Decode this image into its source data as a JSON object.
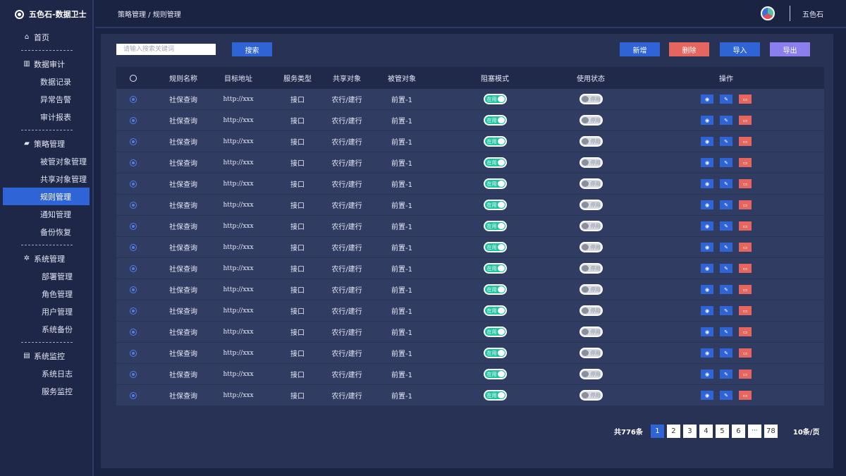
{
  "app": {
    "title": "五色石-数据卫士"
  },
  "header": {
    "breadcrumb": "策略管理 / 规则管理",
    "username": "五色石"
  },
  "sidebar": {
    "groups": [
      {
        "label": "首页",
        "icon": "home-icon",
        "items": []
      },
      {
        "label": "数据审计",
        "icon": "bar-chart-icon",
        "items": [
          "数据记录",
          "异常告警",
          "审计报表"
        ]
      },
      {
        "label": "策略管理",
        "icon": "briefcase-icon",
        "items": [
          "被管对象管理",
          "共享对象管理",
          "规则管理",
          "通知管理",
          "备份恢复"
        ]
      },
      {
        "label": "系统管理",
        "icon": "gear-icon",
        "items": [
          "部署管理",
          "角色管理",
          "用户管理",
          "系统备份"
        ]
      },
      {
        "label": "系统监控",
        "icon": "monitor-icon",
        "items": [
          "系统日志",
          "服务监控"
        ]
      }
    ],
    "active_item": "规则管理"
  },
  "toolbar": {
    "search_placeholder": "请输入搜索关键词",
    "search_label": "搜索",
    "add_label": "新增",
    "delete_label": "删除",
    "import_label": "导入",
    "export_label": "导出"
  },
  "table": {
    "columns": [
      "规则名称",
      "目标地址",
      "服务类型",
      "共享对象",
      "被管对象",
      "阻塞模式",
      "使用状态",
      "操作"
    ],
    "rows": [
      {
        "name": "社保查询",
        "url": "http://xxx",
        "type": "接口",
        "share": "农行/建行",
        "managed": "前置-1",
        "block": "在用",
        "use": "停用"
      },
      {
        "name": "社保查询",
        "url": "http://xxx",
        "type": "接口",
        "share": "农行/建行",
        "managed": "前置-1",
        "block": "在用",
        "use": "停用"
      },
      {
        "name": "社保查询",
        "url": "http://xxx",
        "type": "接口",
        "share": "农行/建行",
        "managed": "前置-1",
        "block": "在用",
        "use": "停用"
      },
      {
        "name": "社保查询",
        "url": "http://xxx",
        "type": "接口",
        "share": "农行/建行",
        "managed": "前置-1",
        "block": "在用",
        "use": "停用"
      },
      {
        "name": "社保查询",
        "url": "http://xxx",
        "type": "接口",
        "share": "农行/建行",
        "managed": "前置-1",
        "block": "在用",
        "use": "停用"
      },
      {
        "name": "社保查询",
        "url": "http://xxx",
        "type": "接口",
        "share": "农行/建行",
        "managed": "前置-1",
        "block": "在用",
        "use": "停用"
      },
      {
        "name": "社保查询",
        "url": "http://xxx",
        "type": "接口",
        "share": "农行/建行",
        "managed": "前置-1",
        "block": "在用",
        "use": "停用"
      },
      {
        "name": "社保查询",
        "url": "http://xxx",
        "type": "接口",
        "share": "农行/建行",
        "managed": "前置-1",
        "block": "在用",
        "use": "停用"
      },
      {
        "name": "社保查询",
        "url": "http://xxx",
        "type": "接口",
        "share": "农行/建行",
        "managed": "前置-1",
        "block": "在用",
        "use": "停用"
      },
      {
        "name": "社保查询",
        "url": "http://xxx",
        "type": "接口",
        "share": "农行/建行",
        "managed": "前置-1",
        "block": "在用",
        "use": "停用"
      },
      {
        "name": "社保查询",
        "url": "http://xxx",
        "type": "接口",
        "share": "农行/建行",
        "managed": "前置-1",
        "block": "在用",
        "use": "停用"
      },
      {
        "name": "社保查询",
        "url": "http://xxx",
        "type": "接口",
        "share": "农行/建行",
        "managed": "前置-1",
        "block": "在用",
        "use": "停用"
      },
      {
        "name": "社保查询",
        "url": "http://xxx",
        "type": "接口",
        "share": "农行/建行",
        "managed": "前置-1",
        "block": "在用",
        "use": "停用"
      },
      {
        "name": "社保查询",
        "url": "http://xxx",
        "type": "接口",
        "share": "农行/建行",
        "managed": "前置-1",
        "block": "在用",
        "use": "停用"
      },
      {
        "name": "社保查询",
        "url": "http://xxx",
        "type": "接口",
        "share": "农行/建行",
        "managed": "前置-1",
        "block": "在用",
        "use": "停用"
      }
    ]
  },
  "pagination": {
    "total": "共776条",
    "pages": [
      "1",
      "2",
      "3",
      "4",
      "5",
      "6",
      "···",
      "78"
    ],
    "current": "1",
    "page_size": "10条/页"
  },
  "colors": {
    "accent": "#2f64d6",
    "danger": "#e4665f",
    "export": "#8b7ff0",
    "toggle_on": "#1ec3a0",
    "background": "#1b2342"
  }
}
